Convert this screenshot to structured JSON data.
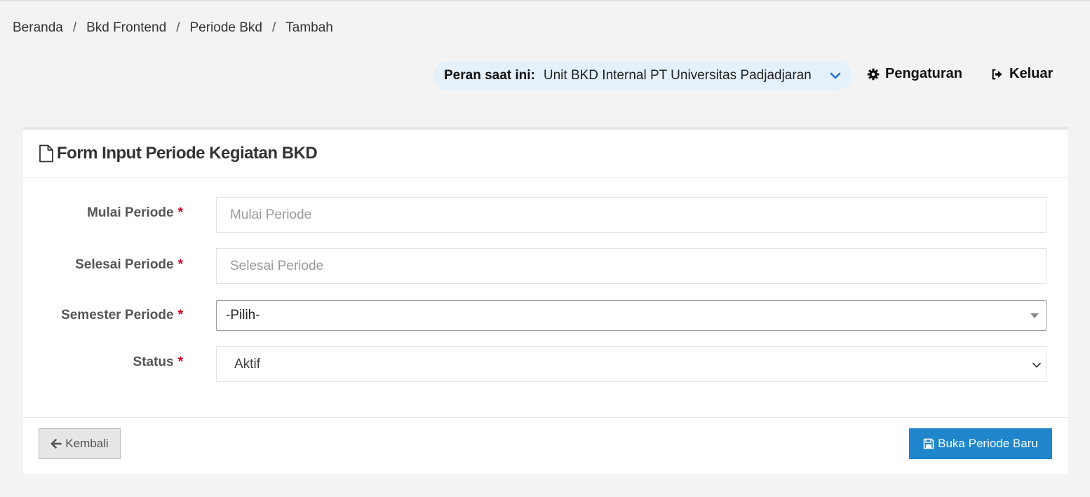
{
  "breadcrumb": {
    "items": [
      "Beranda",
      "Bkd Frontend",
      "Periode Bkd",
      "Tambah"
    ],
    "separator": "/"
  },
  "header": {
    "role_label": "Peran saat ini:",
    "role_value": "Unit BKD Internal PT Universitas Padjadjaran",
    "settings_label": "Pengaturan",
    "logout_label": "Keluar"
  },
  "form": {
    "title": "Form Input Periode Kegiatan BKD",
    "required_mark": "*",
    "mulai": {
      "label": "Mulai Periode",
      "placeholder": "Mulai Periode",
      "value": ""
    },
    "selesai": {
      "label": "Selesai Periode",
      "placeholder": "Selesai Periode",
      "value": ""
    },
    "semester": {
      "label": "Semester Periode",
      "selected": "-Pilih-"
    },
    "status": {
      "label": "Status",
      "selected": "Aktif"
    }
  },
  "footer": {
    "back_label": "Kembali",
    "submit_label": "Buka Periode Baru"
  },
  "colors": {
    "primary": "#1f86cc",
    "required": "#d0021b",
    "role_pill_bg": "#e5f1fa",
    "page_bg": "#f3f3f3"
  },
  "icons": {
    "role": "chevron-down-icon",
    "settings": "gear-icon",
    "logout": "sign-out-icon",
    "title": "file-icon",
    "back": "arrow-left-icon",
    "submit": "floppy-disk-icon"
  }
}
